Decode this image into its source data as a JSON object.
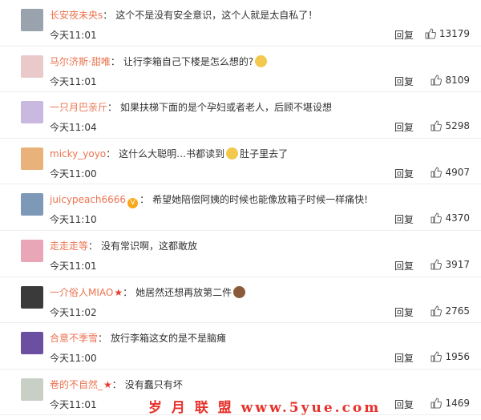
{
  "comments": [
    {
      "user": "长安夜未央s",
      "text": "这个不是没有安全意识，这个人就是太自私了！",
      "time": "今天11:01",
      "reply": "回复",
      "likes": "13179",
      "avatar_color": "#9aa3ad",
      "badge": false,
      "star": false
    },
    {
      "user": "马尔济斯·甜唯",
      "text": "让行李箱自己下楼是怎么想的?",
      "time": "今天11:01",
      "reply": "回复",
      "likes": "8109",
      "avatar_color": "#e9c9c9",
      "badge": false,
      "star": false,
      "emoji": "smirk-emoji"
    },
    {
      "user": "一只月巴亲斤",
      "text": "如果扶梯下面的是个孕妇或者老人，后顾不堪设想",
      "time": "今天11:04",
      "reply": "回复",
      "likes": "5298",
      "avatar_color": "#c9b8e0",
      "badge": false,
      "star": false
    },
    {
      "user": "micky_yoyo",
      "text": "这什么大聪明…书都读到",
      "text2": "肚子里去了",
      "time": "今天11:00",
      "reply": "回复",
      "likes": "4907",
      "avatar_color": "#e8b27a",
      "badge": false,
      "star": false,
      "emoji": "dog-emoji"
    },
    {
      "user": "juicypeach6666",
      "text": "希望她陪偿阿姨的时候也能像放箱子时候一样痛快!",
      "time": "今天11:10",
      "reply": "回复",
      "likes": "4370",
      "avatar_color": "#7e98b8",
      "badge": true,
      "star": false
    },
    {
      "user": "走走走等",
      "text": "没有常识啊，这都敢放",
      "time": "今天11:01",
      "reply": "回复",
      "likes": "3917",
      "avatar_color": "#e8a6b6",
      "badge": false,
      "star": false
    },
    {
      "user": "一介俗人MIAO",
      "text": "她居然还想再放第二件",
      "time": "今天11:02",
      "reply": "回复",
      "likes": "2765",
      "avatar_color": "#3a3a3a",
      "badge": false,
      "star": true,
      "emoji": "monkey-emoji"
    },
    {
      "user": "合意不季雪",
      "text": "放行李箱这女的是不是脑瘫",
      "time": "今天11:00",
      "reply": "回复",
      "likes": "1956",
      "avatar_color": "#6b4fa0",
      "badge": false,
      "star": false
    },
    {
      "user": "卷的不自然_",
      "text": "没有蠢只有坏",
      "time": "今天11:01",
      "reply": "回复",
      "likes": "1469",
      "avatar_color": "#c8cfc4",
      "badge": false,
      "star": true
    }
  ],
  "watermark": "岁 月 联 盟   www.5yue.com",
  "colors": {
    "username": "#eb7350",
    "star": "#e83a2e",
    "badge": "#f7a81b",
    "watermark": "#e8312a"
  }
}
